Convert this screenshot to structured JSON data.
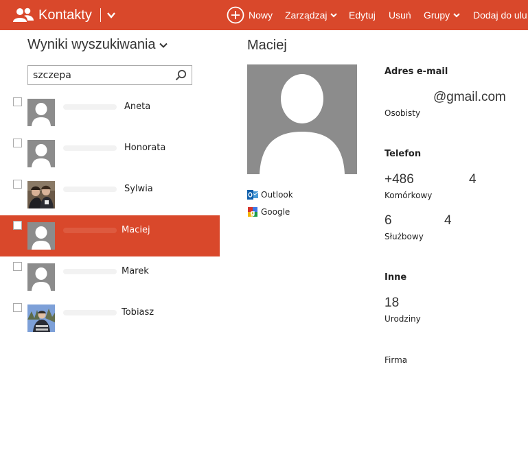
{
  "header": {
    "app_title": "Kontakty",
    "commands": [
      {
        "label": "Nowy"
      },
      {
        "label": "Zarządzaj"
      },
      {
        "label": "Edytuj"
      },
      {
        "label": "Usuń"
      },
      {
        "label": "Grupy"
      },
      {
        "label": "Dodaj do ulu"
      }
    ]
  },
  "list": {
    "title": "Wyniki wyszukiwania",
    "search": {
      "value": "szczepa"
    },
    "items": [
      {
        "name": "Aneta",
        "selected": false
      },
      {
        "name": "Honorata",
        "selected": false
      },
      {
        "name": "Sylwia",
        "selected": false
      },
      {
        "name": "Maciej",
        "selected": true
      },
      {
        "name": "Marek",
        "selected": false
      },
      {
        "name": "Tobiasz",
        "selected": false
      }
    ]
  },
  "detail": {
    "name": "Maciej",
    "sources": [
      "Outlook",
      "Google"
    ],
    "email": {
      "heading": "Adres e-mail",
      "value": "@gmail.com",
      "label": "Osobisty"
    },
    "phone": {
      "heading": "Telefon",
      "mobile": {
        "value_start": "+486",
        "value_end": "4",
        "label": "Komórkowy"
      },
      "work": {
        "value_start": "6",
        "value_end": "4",
        "label": "Służbowy"
      }
    },
    "other": {
      "heading": "Inne",
      "birthday": {
        "value": "18",
        "label": "Urodziny"
      },
      "company": {
        "label": "Firma"
      }
    }
  },
  "colors": {
    "accent": "#d9482b",
    "placeholder_avatar": "#8c8c8c"
  }
}
